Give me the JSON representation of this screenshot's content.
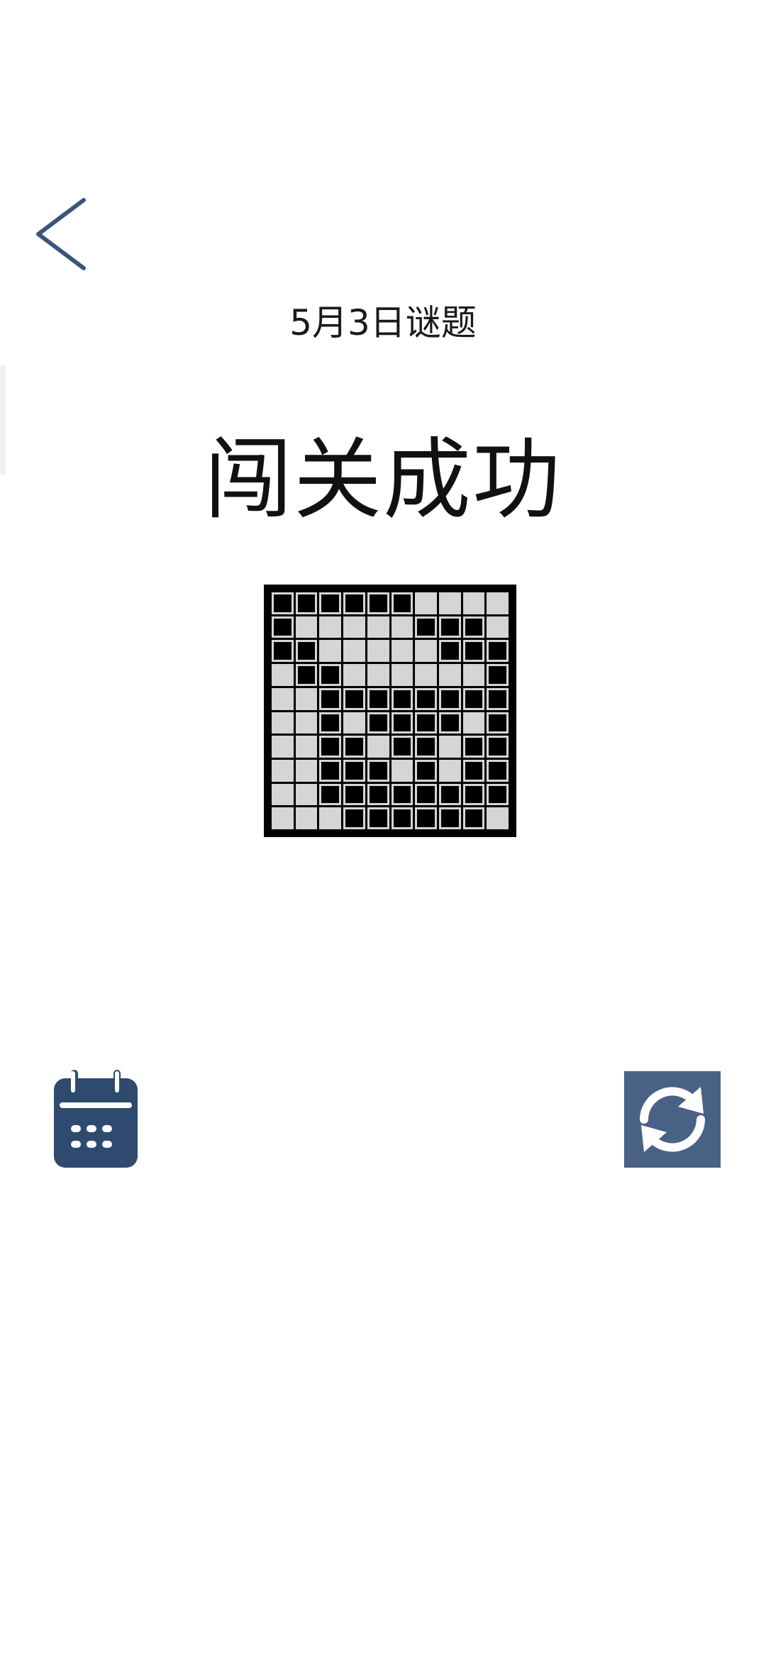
{
  "header": {
    "back_icon": "chevron-left-icon"
  },
  "puzzle": {
    "subtitle": "5月3日谜题",
    "status_title": "闯关成功",
    "grid_size": 10,
    "grid_rows": [
      "1111110000",
      "1000001110",
      "1100000111",
      "0110000001",
      "0011111111",
      "0010111101",
      "0011011011",
      "0011101011",
      "0011111111",
      "0001111110"
    ]
  },
  "actions": {
    "calendar_icon": "calendar-icon",
    "refresh_icon": "refresh-icon"
  },
  "colors": {
    "accent": "#2e4a6e",
    "refresh_bg": "#4a6186",
    "cell_empty": "#d4d5d7",
    "cell_filled": "#000000"
  }
}
